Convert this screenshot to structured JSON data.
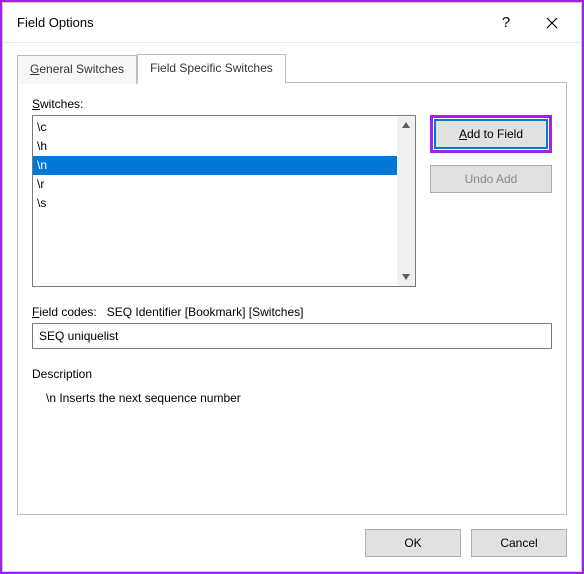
{
  "window": {
    "title": "Field Options",
    "help": "?",
    "close": "✕"
  },
  "tabs": {
    "general": {
      "hot": "G",
      "rest": "eneral Switches"
    },
    "specific": "Field Specific Switches"
  },
  "switches": {
    "label_hot": "S",
    "label_rest": "witches:",
    "items": [
      "\\c",
      "\\h",
      "\\n",
      "\\r",
      "\\s"
    ],
    "selected_index": 2
  },
  "buttons": {
    "add_hot": "A",
    "add_rest": "dd to Field",
    "undo": "Undo Add"
  },
  "fieldcodes": {
    "label_hot": "F",
    "label_rest": "ield codes:",
    "syntax": "SEQ Identifier [Bookmark] [Switches]",
    "value": "SEQ uniquelist"
  },
  "description": {
    "label": "Description",
    "text": "\\n Inserts the next sequence number"
  },
  "footer": {
    "ok": "OK",
    "cancel": "Cancel"
  }
}
